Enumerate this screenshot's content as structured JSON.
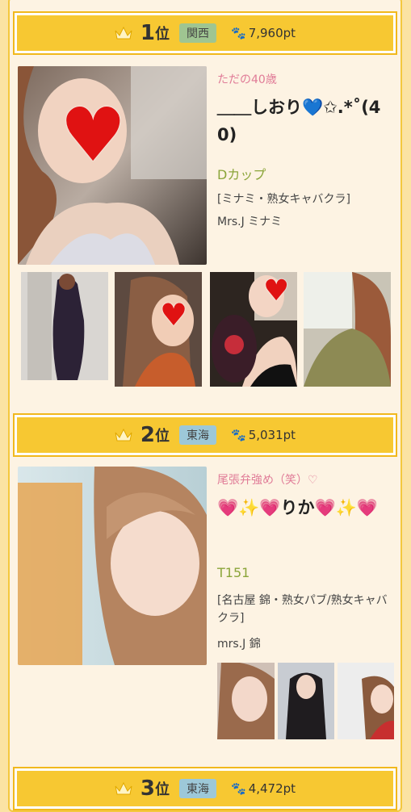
{
  "ranking": [
    {
      "rank": "1",
      "rank_suffix": "位",
      "region": "関西",
      "points": "7,960pt",
      "tagline": "ただの40歳",
      "name": "＿＿しおり💙✩.*˚(40)",
      "cup": "Dカップ",
      "area": "[ミナミ・熟女キャバクラ]",
      "shop": "Mrs.J ミナミ"
    },
    {
      "rank": "2",
      "rank_suffix": "位",
      "region": "東海",
      "points": "5,031pt",
      "tagline": "尾張弁強め（笑）♡",
      "name": "💗✨💗りか💗✨💗",
      "cup": "T151",
      "area": "[名古屋 錦・熟女パブ/熟女キャバクラ]",
      "shop": "mrs.J 錦"
    },
    {
      "rank": "3",
      "rank_suffix": "位",
      "region": "東海",
      "points": "4,472pt"
    }
  ],
  "icons": {
    "crown": "crown-icon",
    "paw": "paw-icon"
  },
  "colors": {
    "bar": "#f7c832",
    "tagline": "#e07b97",
    "cup": "#8ba53a",
    "region_kansai": "#9fc591",
    "region_tokai": "#9dc8d8"
  }
}
